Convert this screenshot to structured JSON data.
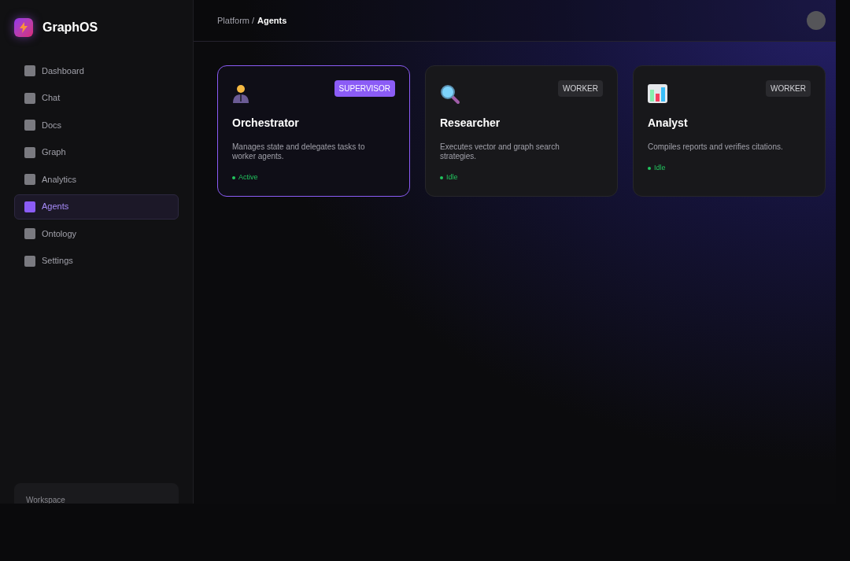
{
  "brand": {
    "name": "GraphOS"
  },
  "sidebar": {
    "items": [
      {
        "label": "Dashboard",
        "selected": false
      },
      {
        "label": "Chat",
        "selected": false
      },
      {
        "label": "Docs",
        "selected": false
      },
      {
        "label": "Graph",
        "selected": false
      },
      {
        "label": "Analytics",
        "selected": false
      },
      {
        "label": "Agents",
        "selected": true
      },
      {
        "label": "Ontology",
        "selected": false
      },
      {
        "label": "Settings",
        "selected": false
      }
    ],
    "footer_card": {
      "label": "Workspace"
    }
  },
  "breadcrumb": {
    "parent": "Platform /",
    "current": "Agents"
  },
  "agents": [
    {
      "badge": "SUPERVISOR",
      "kind": "supervisor",
      "name": "Orchestrator",
      "description": "Manages state and delegates tasks to worker agents.",
      "status": "Active",
      "selected": true
    },
    {
      "badge": "WORKER",
      "kind": "worker",
      "name": "Researcher",
      "description": "Executes vector and graph search strategies.",
      "status": "Idle",
      "selected": false
    },
    {
      "badge": "WORKER",
      "kind": "worker",
      "name": "Analyst",
      "description": "Compiles reports and verifies citations.",
      "status": "Idle",
      "selected": false
    }
  ]
}
